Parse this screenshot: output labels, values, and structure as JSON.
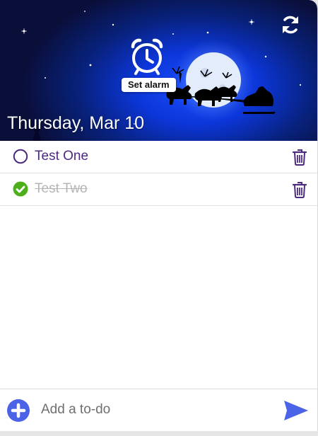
{
  "header": {
    "date": "Thursday, Mar 10",
    "alarm_tooltip": "Set alarm",
    "background_scene": "santa-sleigh-moon-night"
  },
  "todos": [
    {
      "text": "Test One",
      "done": false
    },
    {
      "text": "Test Two",
      "done": true
    }
  ],
  "composer": {
    "placeholder": "Add a to-do",
    "value": ""
  },
  "colors": {
    "accent": "#4a63e7",
    "todo_text": "#4b2a80",
    "done_check": "#4caf1a",
    "done_text": "#b5b5b5"
  },
  "icons": {
    "refresh": "refresh-icon",
    "alarm": "alarm-clock-icon",
    "unchecked": "circle-outline-icon",
    "checked": "check-circle-icon",
    "delete": "trash-icon",
    "add": "plus-circle-icon",
    "send": "send-arrow-icon"
  }
}
